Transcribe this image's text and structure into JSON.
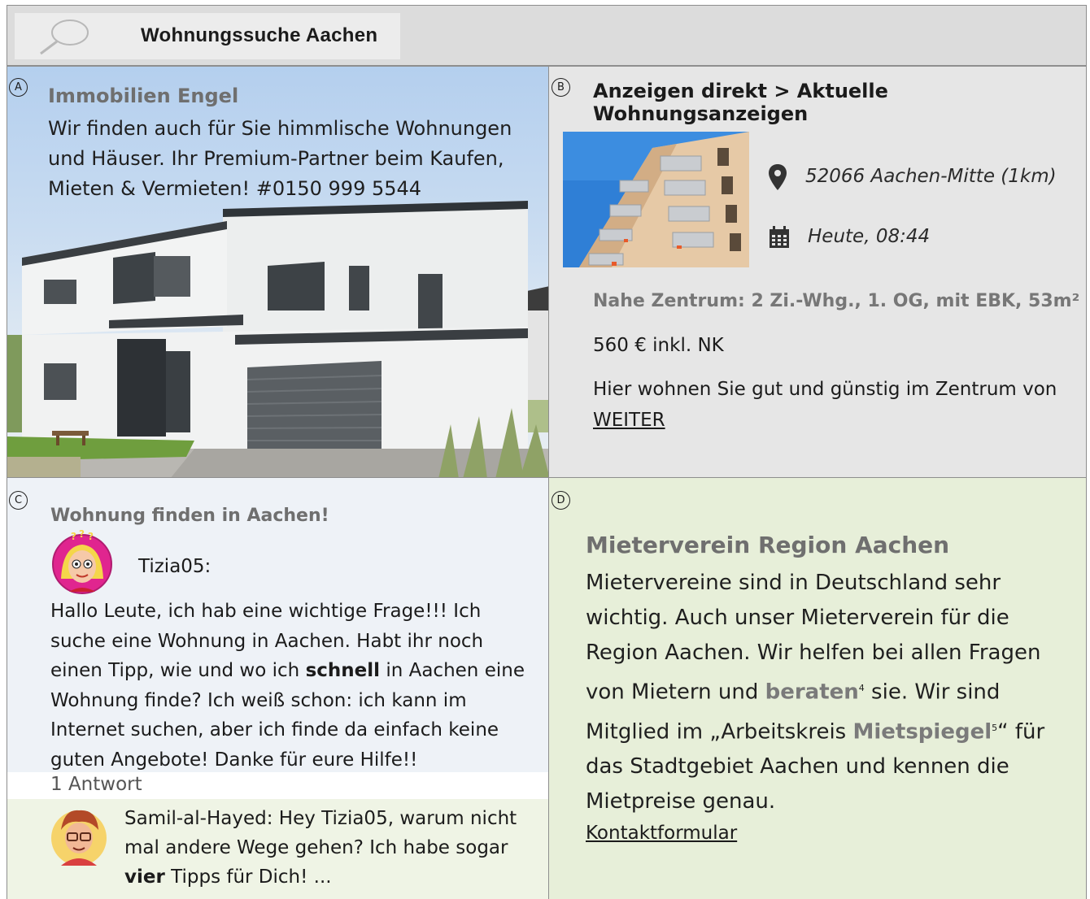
{
  "search": {
    "title": "Wohnungssuche Aachen"
  },
  "panelA": {
    "marker": "A",
    "name": "Immobilien Engel",
    "text": "Wir finden auch für Sie himmlische Wohnungen und Häuser. Ihr Premium-Partner beim Kaufen, Mieten & Vermieten! #0150 999 5544"
  },
  "panelB": {
    "marker": "B",
    "heading": "Anzeigen direkt > Aktuelle Wohnungsanzeigen",
    "location": "52066 Aachen-Mitte (1km)",
    "date": "Heute, 08:44",
    "listing_title": "Nahe Zentrum: 2 Zi.-Whg., 1. OG, mit EBK, 53m²",
    "price": "560 € inkl. NK",
    "desc": "Hier wohnen Sie gut und günstig im Zentrum von",
    "more_link": "WEITER"
  },
  "panelC": {
    "marker": "C",
    "title": "Wohnung finden in Aachen!",
    "user": "Tizia05:",
    "post_a": "Hallo Leute, ich hab eine wichtige Frage!!! Ich suche eine Wohnung in Aachen. Habt ihr noch einen Tipp, wie und wo ich",
    "post_bold": "schnell",
    "post_b": "in Aachen eine Wohnung finde? Ich weiß schon: ich kann im Internet suchen, aber ich finde da einfach keine guten Angebote! Danke für eure Hilfe!!",
    "answer_count": "1 Antwort",
    "reply_a": "Samil-al-Hayed: Hey Tizia05, warum nicht mal andere Wege gehen? Ich habe sogar",
    "reply_bold": "vier",
    "reply_b": "Tipps für Dich! ..."
  },
  "panelD": {
    "marker": "D",
    "title": "Mieterverein Region Aachen",
    "text_a": "Mietervereine sind in Deutschland sehr wichtig. Auch unser Mieterverein für die Region Aachen. Wir helfen bei allen Fragen von Mietern und",
    "term1": "beraten",
    "sup1": "4",
    "text_b": "sie. Wir sind Mitglied im „Arbeitskreis",
    "term2": "Mietspiegel",
    "sup2": "5",
    "text_c": "“ für das Stadtgebiet Aachen und kennen die Mietpreise genau.",
    "contact_link": "Kontaktformular"
  }
}
